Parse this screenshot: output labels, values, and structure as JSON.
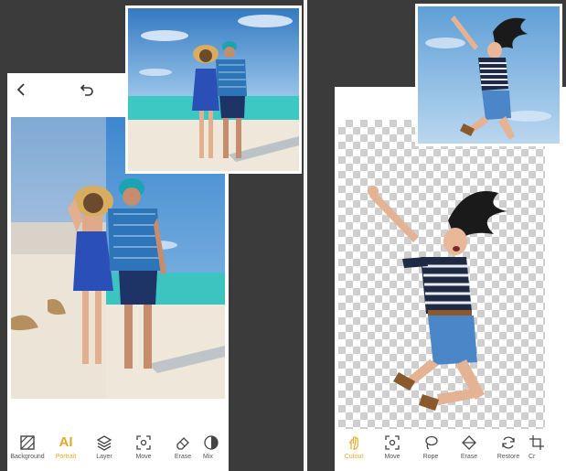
{
  "left_panel": {
    "toolbar": [
      {
        "label": "Background",
        "icon": "background-icon",
        "active": false
      },
      {
        "label": "Portrait",
        "icon": "ai-icon",
        "glyph": "AI",
        "active": true
      },
      {
        "label": "Layer",
        "icon": "layer-icon",
        "active": false
      },
      {
        "label": "Move",
        "icon": "move-icon",
        "active": false
      },
      {
        "label": "Erase",
        "icon": "eraser-icon",
        "active": false
      },
      {
        "label": "Mix",
        "icon": "mix-icon",
        "active": false
      }
    ],
    "topbar_icons": [
      "back-arrow-icon",
      "undo-icon"
    ]
  },
  "right_panel": {
    "toolbar": [
      {
        "label": "Cutout",
        "icon": "cutout-hand-icon",
        "active": true
      },
      {
        "label": "Move",
        "icon": "move-icon",
        "active": false
      },
      {
        "label": "Rope",
        "icon": "lasso-icon",
        "active": false
      },
      {
        "label": "Erase",
        "icon": "eraser-icon",
        "active": false
      },
      {
        "label": "Restore",
        "icon": "restore-icon",
        "active": false
      },
      {
        "label": "Cr",
        "icon": "crop-icon",
        "active": false
      }
    ]
  },
  "colors": {
    "accent": "#e5a92b",
    "frame_bg": "#3b3b3b",
    "sky": "#5f9fd6",
    "sea": "#3fc7c3",
    "sand": "#efe6d6"
  }
}
